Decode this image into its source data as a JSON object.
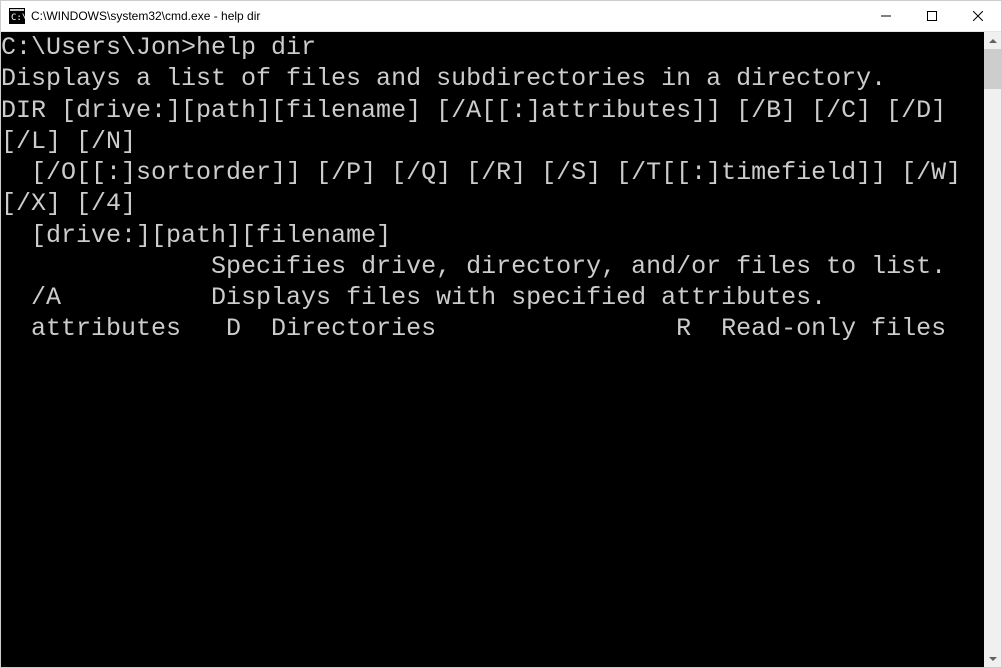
{
  "window": {
    "title": "C:\\WINDOWS\\system32\\cmd.exe - help  dir"
  },
  "terminal": {
    "lines": [
      "",
      "C:\\Users\\Jon>help dir",
      "Displays a list of files and subdirectories in a directory.",
      "",
      "DIR [drive:][path][filename] [/A[[:]attributes]] [/B] [/C] [/D] [/L] [/N]",
      "  [/O[[:]sortorder]] [/P] [/Q] [/R] [/S] [/T[[:]timefield]] [/W] [/X] [/4]",
      "",
      "  [drive:][path][filename]",
      "              Specifies drive, directory, and/or files to list.",
      "",
      "  /A          Displays files with specified attributes.",
      "  attributes   D  Directories                R  Read-only files"
    ]
  }
}
